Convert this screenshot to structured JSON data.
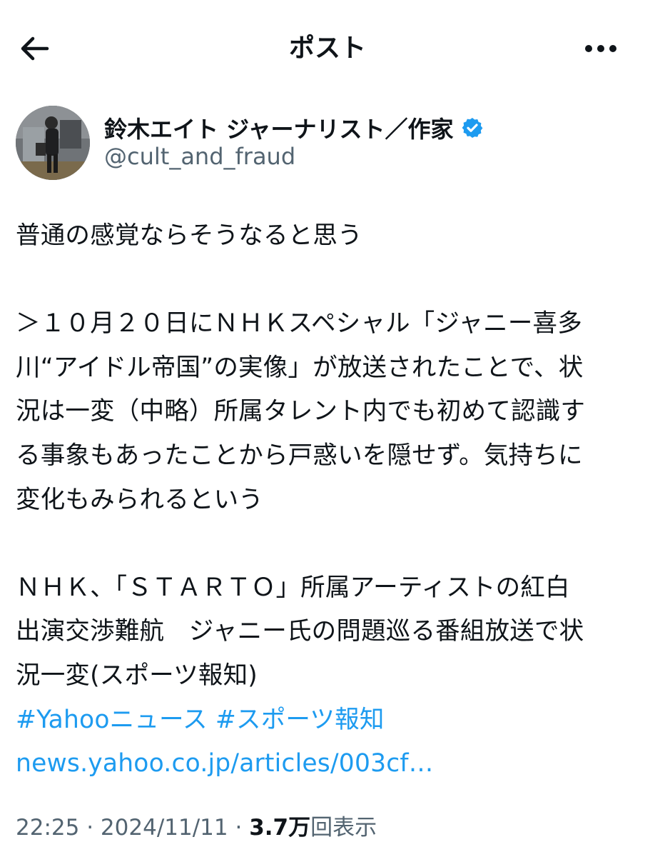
{
  "header": {
    "title": "ポスト",
    "back_icon": "arrow-left-icon",
    "more_icon": "more-dots-icon"
  },
  "author": {
    "display_name": "鈴木エイト ジャーナリスト／作家",
    "handle": "@cult_and_fraud",
    "verified_color": "#1d9bf0"
  },
  "post": {
    "lines": [
      "普通の感覚ならそうなると思う",
      "",
      "＞１０月２０日にＮＨＫスペシャル「ジャニー喜多",
      "川“アイドル帝国”の実像」が放送されたことで、状",
      "況は一変（中略）所属タレント内でも初めて認識す",
      "る事象もあったことから戸惑いを隠せず。気持ちに",
      "変化もみられるという",
      "",
      "ＮＨＫ、「ＳＴＡＲＴＯ」所属アーティストの紅白",
      "出演交渉難航　ジャニー氏の問題巡る番組放送で状",
      "況一変(スポーツ報知)"
    ],
    "hashtag1": "#Yahooニュース",
    "hashtag2": "#スポーツ報知",
    "link": "news.yahoo.co.jp/articles/003cf…",
    "link_color": "#1d9bf0"
  },
  "meta": {
    "time": "22:25",
    "date": "2024/11/11",
    "views_count": "3.7",
    "views_unit": "万",
    "views_label": "回表示"
  }
}
